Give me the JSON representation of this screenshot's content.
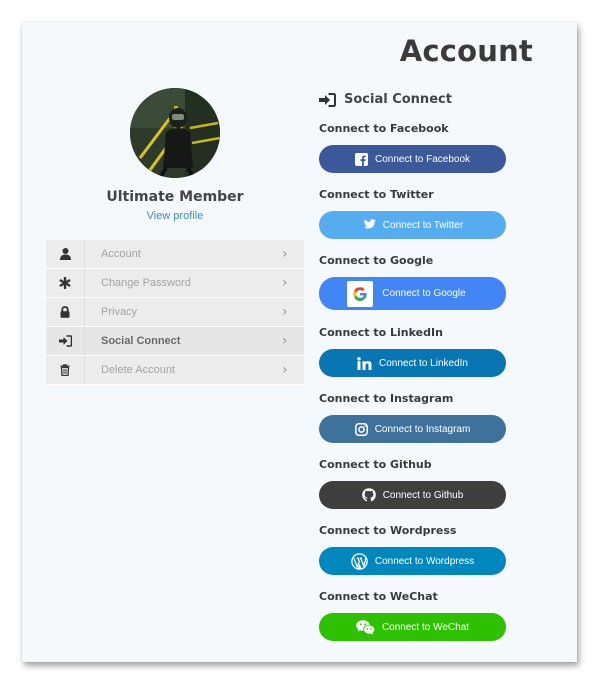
{
  "page": {
    "title": "Account"
  },
  "profile": {
    "name": "Ultimate Member",
    "view_profile_label": "View profile"
  },
  "menu": {
    "items": [
      {
        "label": "Account",
        "icon": "user-icon"
      },
      {
        "label": "Change Password",
        "icon": "asterisk-icon"
      },
      {
        "label": "Privacy",
        "icon": "lock-icon"
      },
      {
        "label": "Social Connect",
        "icon": "sign-in-icon",
        "active": true
      },
      {
        "label": "Delete Account",
        "icon": "trash-icon"
      }
    ]
  },
  "social": {
    "title": "Social Connect",
    "title_icon": "sign-in-icon",
    "providers": [
      {
        "heading": "Connect to Facebook",
        "button_label": "Connect to Facebook",
        "color": "#3b5998",
        "icon": "facebook-icon"
      },
      {
        "heading": "Connect to Twitter",
        "button_label": "Connect to Twitter",
        "color": "#55acee",
        "icon": "twitter-icon"
      },
      {
        "heading": "Connect to Google",
        "button_label": "Connect to Google",
        "color": "#4285f4",
        "icon": "google-icon"
      },
      {
        "heading": "Connect to LinkedIn",
        "button_label": "Connect to LinkedIn",
        "color": "#0976b4",
        "icon": "linkedin-icon"
      },
      {
        "heading": "Connect to Instagram",
        "button_label": "Connect to Instagram",
        "color": "#3f729b",
        "icon": "instagram-icon"
      },
      {
        "heading": "Connect to Github",
        "button_label": "Connect to Github",
        "color": "#3f3f3f",
        "icon": "github-icon"
      },
      {
        "heading": "Connect to Wordpress",
        "button_label": "Connect to Wordpress",
        "color": "#0087be",
        "icon": "wordpress-icon"
      },
      {
        "heading": "Connect to WeChat",
        "button_label": "Connect to WeChat",
        "color": "#2dc100",
        "icon": "wechat-icon"
      }
    ]
  }
}
